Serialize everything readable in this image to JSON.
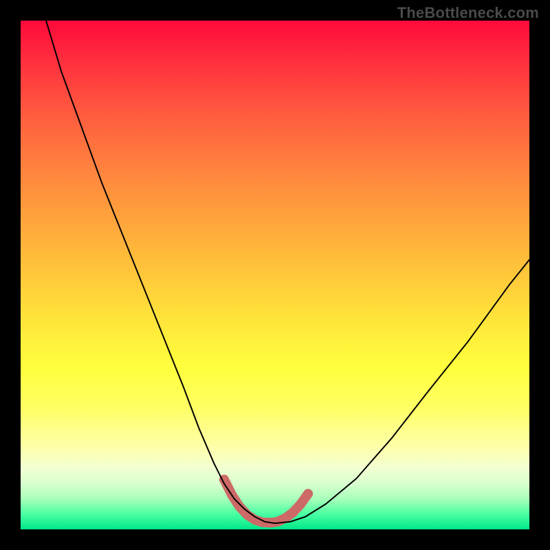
{
  "watermark": {
    "text": "TheBottleneck.com"
  },
  "chart_data": {
    "type": "line",
    "title": "",
    "xlabel": "",
    "ylabel": "",
    "xlim": [
      0,
      100
    ],
    "ylim": [
      0,
      100
    ],
    "gradient_stops": [
      {
        "pct": 0,
        "color": "#ff0a3a"
      },
      {
        "pct": 8,
        "color": "#ff2f3e"
      },
      {
        "pct": 18,
        "color": "#ff5a3f"
      },
      {
        "pct": 28,
        "color": "#ff7f3e"
      },
      {
        "pct": 38,
        "color": "#ffa03c"
      },
      {
        "pct": 48,
        "color": "#ffc13a"
      },
      {
        "pct": 58,
        "color": "#ffe23a"
      },
      {
        "pct": 68,
        "color": "#ffff3d"
      },
      {
        "pct": 76,
        "color": "#ffff63"
      },
      {
        "pct": 84,
        "color": "#fdffab"
      },
      {
        "pct": 88,
        "color": "#f2ffd2"
      },
      {
        "pct": 91,
        "color": "#d9ffcf"
      },
      {
        "pct": 94,
        "color": "#a8ffb9"
      },
      {
        "pct": 97,
        "color": "#4affa3"
      },
      {
        "pct": 100,
        "color": "#00e789"
      }
    ],
    "series": [
      {
        "name": "thin-curve",
        "stroke": "#000000",
        "stroke_width": 2,
        "x": [
          5,
          8,
          12,
          16,
          20,
          24,
          28,
          32,
          35,
          38,
          40,
          42,
          44,
          46,
          48,
          50,
          53,
          56,
          60,
          66,
          73,
          80,
          88,
          96,
          100
        ],
        "y": [
          100,
          90,
          79,
          68,
          58,
          48,
          38,
          28,
          20,
          13,
          9,
          6,
          4,
          2.5,
          1.5,
          1.2,
          1.5,
          2.5,
          5,
          10,
          18,
          27,
          37,
          48,
          53
        ]
      },
      {
        "name": "thick-bottom-curve",
        "stroke": "#cd6a67",
        "stroke_width": 14,
        "x": [
          40,
          41.5,
          43,
          44.5,
          46,
          47.5,
          49,
          50.5,
          52,
          53.5,
          55,
          56.5
        ],
        "y": [
          9.8,
          6.8,
          4.5,
          2.9,
          1.9,
          1.4,
          1.3,
          1.5,
          2.2,
          3.3,
          4.9,
          7.0
        ]
      }
    ],
    "markers": [
      {
        "x": 40,
        "y": 9.8,
        "r": 7,
        "color": "#cd6a67"
      },
      {
        "x": 41.5,
        "y": 6.8,
        "r": 7,
        "color": "#cd6a67"
      },
      {
        "x": 52,
        "y": 2.2,
        "r": 7,
        "color": "#cd6a67"
      },
      {
        "x": 53.5,
        "y": 3.3,
        "r": 7,
        "color": "#cd6a67"
      },
      {
        "x": 55,
        "y": 4.9,
        "r": 7,
        "color": "#cd6a67"
      },
      {
        "x": 56.5,
        "y": 7.0,
        "r": 7,
        "color": "#cd6a67"
      }
    ]
  }
}
